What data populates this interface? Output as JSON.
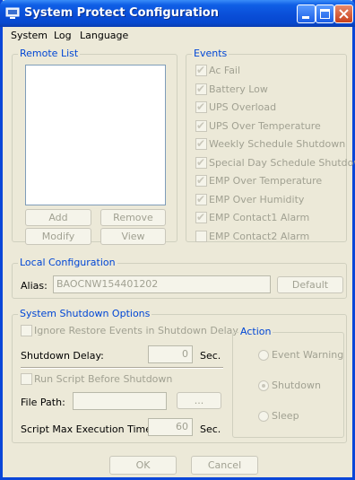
{
  "window": {
    "title": "System Protect Configuration"
  },
  "menu": [
    "System",
    "Log",
    "Language"
  ],
  "remote_list": {
    "legend": "Remote List",
    "buttons": {
      "add": "Add",
      "remove": "Remove",
      "modify": "Modify",
      "view": "View"
    }
  },
  "events": {
    "legend": "Events",
    "items": [
      {
        "label": "Ac Fail",
        "checked": true
      },
      {
        "label": "Battery Low",
        "checked": true
      },
      {
        "label": "UPS Overload",
        "checked": true
      },
      {
        "label": "UPS Over Temperature",
        "checked": true
      },
      {
        "label": "Weekly Schedule Shutdown",
        "checked": true
      },
      {
        "label": "Special Day Schedule Shutdown",
        "checked": true
      },
      {
        "label": "EMP Over Temperature",
        "checked": true
      },
      {
        "label": "EMP Over Humidity",
        "checked": true
      },
      {
        "label": "EMP Contact1 Alarm",
        "checked": true
      },
      {
        "label": "EMP Contact2 Alarm",
        "checked": false
      }
    ]
  },
  "local_config": {
    "legend": "Local Configuration",
    "alias_label": "Alias:",
    "alias_value": "BAOCNW154401202",
    "default_button": "Default"
  },
  "shutdown": {
    "legend": "System Shutdown Options",
    "ignore_restore_label": "Ignore Restore Events in Shutdown Delay",
    "shutdown_delay_label": "Shutdown Delay:",
    "shutdown_delay_value": "0",
    "shutdown_delay_unit": "Sec.",
    "run_script_label": "Run Script Before Shutdown",
    "file_path_label": "File Path:",
    "file_path_value": "",
    "browse_button": "...",
    "script_max_label": "Script Max Execution Time:",
    "script_max_value": "60",
    "script_max_unit": "Sec."
  },
  "action": {
    "legend": "Action",
    "options": [
      {
        "label": "Event Warning",
        "selected": false
      },
      {
        "label": "Shutdown",
        "selected": true
      },
      {
        "label": "Sleep",
        "selected": false
      }
    ]
  },
  "footer": {
    "ok": "OK",
    "cancel": "Cancel"
  }
}
